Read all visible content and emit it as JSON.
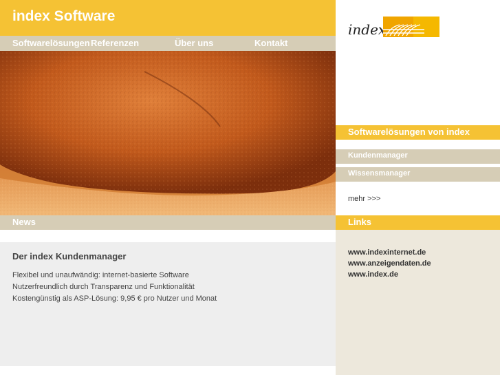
{
  "header": {
    "site_title": "index Software"
  },
  "nav": {
    "items": [
      {
        "label": "Softwarelösungen"
      },
      {
        "label": "Referenzen"
      },
      {
        "label": "Über uns"
      },
      {
        "label": "Kontakt"
      }
    ]
  },
  "logo": {
    "text": "index"
  },
  "products": {
    "title": "Softwarelösungen von index",
    "items": [
      {
        "label": "Kundenmanager"
      },
      {
        "label": "Wissensmanager"
      }
    ],
    "more_label": "mehr >>>"
  },
  "news": {
    "title": "News",
    "article_title": "Der index Kundenmanager",
    "lines": [
      "Flexibel und unaufwändig: internet-basierte Software",
      "Nutzerfreundlich durch Transparenz und Funktionalität",
      "Kostengünstig als ASP-Lösung: 9,95 € pro Nutzer und Monat"
    ]
  },
  "links": {
    "title": "Links",
    "items": [
      {
        "label": "www.indexinternet.de"
      },
      {
        "label": "www.anzeigendaten.de"
      },
      {
        "label": "www.index.de"
      }
    ]
  },
  "colors": {
    "accent_yellow": "#f5c234",
    "nav_tan": "#d6cdb6",
    "panel_beige": "#ede8dc",
    "panel_gray": "#eeeeee"
  },
  "icons": {
    "hero_image": "sandstone-rock-photo",
    "logo_mark": "orange-stripes-logo"
  }
}
